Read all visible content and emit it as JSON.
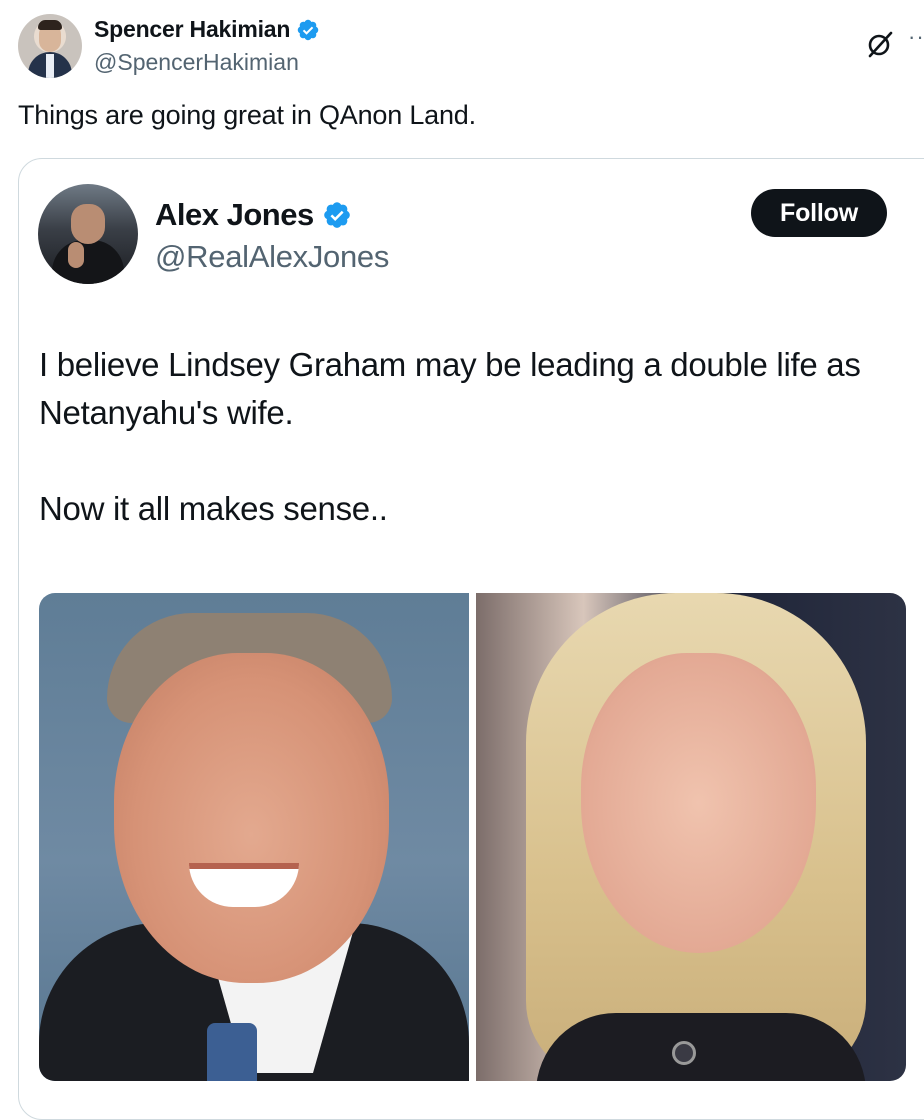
{
  "author": {
    "display_name": "Spencer Hakimian",
    "handle": "@SpencerHakimian"
  },
  "tweet": {
    "text": "Things are going great in QAnon Land."
  },
  "quote": {
    "display_name": "Alex Jones",
    "handle": "@RealAlexJones",
    "follow_label": "Follow",
    "line1": "I believe Lindsey Graham may be leading a double life as Netanyahu's wife.",
    "line2": "Now it all makes sense..",
    "images": [
      "portrait-photo-man",
      "portrait-photo-woman"
    ]
  },
  "icons": {
    "verified": "verified-badge",
    "grok": "grok-icon",
    "more": "more-icon"
  },
  "colors": {
    "verified_blue": "#1d9bf0",
    "text": "#0f1419",
    "secondary_text": "#536471",
    "border": "#cfd9de",
    "follow_bg": "#0f1419"
  }
}
